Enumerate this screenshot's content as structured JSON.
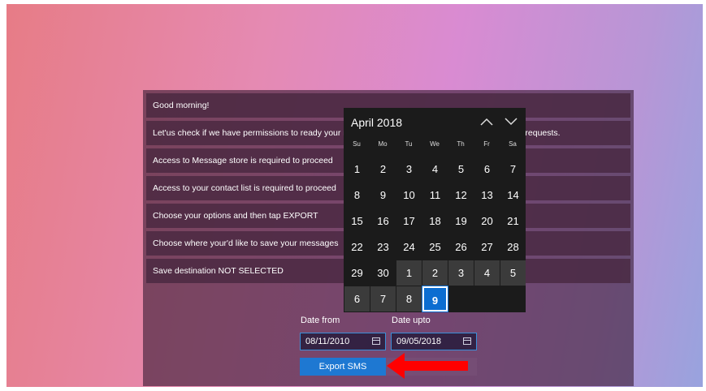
{
  "messages": [
    "Good morning!",
    "Let'us check if we have permissions to ready your messages. Please accept any Message Access requests.",
    "Access to Message store is required to proceed",
    "Access to your contact list is required to proceed",
    "Choose your options and then tap EXPORT",
    "Choose where your'd like to save your messages",
    "Save destination NOT SELECTED"
  ],
  "dates": {
    "from_label": "Date from",
    "from_value": "08/11/2010",
    "upto_label": "Date upto",
    "upto_value": "09/05/2018"
  },
  "export_label": "Export SMS",
  "calendar": {
    "title": "April 2018",
    "weekdays": [
      "Su",
      "Mo",
      "Tu",
      "We",
      "Th",
      "Fr",
      "Sa"
    ],
    "weeks": [
      [
        "1",
        "2",
        "3",
        "4",
        "5",
        "6",
        "7"
      ],
      [
        "8",
        "9",
        "10",
        "11",
        "12",
        "13",
        "14"
      ],
      [
        "15",
        "16",
        "17",
        "18",
        "19",
        "20",
        "21"
      ],
      [
        "22",
        "23",
        "24",
        "25",
        "26",
        "27",
        "28"
      ],
      [
        "29",
        "30",
        "1",
        "2",
        "3",
        "4",
        "5"
      ],
      [
        "6",
        "7",
        "8",
        "9"
      ]
    ],
    "today": "9",
    "up_icon": "chevron-up-icon",
    "down_icon": "chevron-down-icon"
  },
  "colors": {
    "accent": "#1e78d2",
    "arrow": "#ff0000"
  }
}
